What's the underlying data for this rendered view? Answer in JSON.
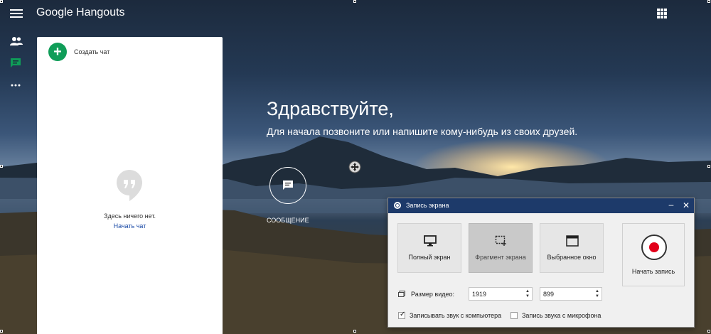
{
  "app": {
    "logo_google": "Google",
    "logo_product": "Hangouts"
  },
  "sidebar": {
    "items": [
      {
        "icon": "people-icon"
      },
      {
        "icon": "chat-icon",
        "color": "#0f9d58"
      },
      {
        "icon": "more-icon"
      }
    ]
  },
  "chat_panel": {
    "new_chat_label": "Создать чат",
    "empty_text": "Здесь ничего нет.",
    "start_chat_link": "Начать чат"
  },
  "welcome": {
    "title": "Здравствуйте,",
    "subtitle": "Для начала позвоните или напишите кому-нибудь из своих друзей.",
    "message_button_label": "СООБЩЕНИЕ"
  },
  "recorder": {
    "title": "Запись экрана",
    "modes": [
      {
        "label": "Полный экран",
        "icon": "monitor-icon",
        "active": false
      },
      {
        "label": "Фрагмент экрана",
        "icon": "region-select-icon",
        "active": true
      },
      {
        "label": "Выбранное окно",
        "icon": "window-icon",
        "active": false
      }
    ],
    "start_record_label": "Начать запись",
    "video_size_label": "Размер видео:",
    "width_value": "1919",
    "height_value": "899",
    "record_computer_audio_label": "Записывать звук с компьютера",
    "record_computer_audio_checked": true,
    "record_mic_audio_label": "Запись звука с микрофона",
    "record_mic_audio_checked": false
  },
  "colors": {
    "accent_green": "#0f9d58",
    "dialog_title_bar": "#1d3a6a",
    "record_red": "#e2001a",
    "link_blue": "#1a4aa6"
  }
}
